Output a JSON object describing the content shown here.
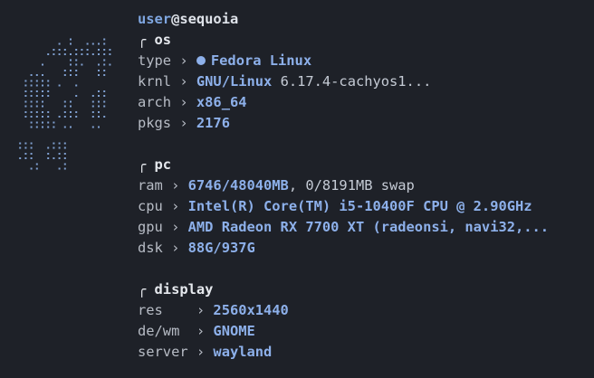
{
  "prompt": {
    "user": "user",
    "at": "@",
    "host": "sequoia"
  },
  "colors": {
    "background": "#1e2128",
    "accent": "#8db0ea",
    "text": "#c5cbd5"
  },
  "logo": {
    "icon": "fedora-ascii-dot-logo"
  },
  "sections": {
    "os": {
      "header": "╭ os",
      "type_key": "type ›",
      "type_val": "Fedora Linux",
      "type_icon": "fedora-icon",
      "krnl_key": "krnl ›",
      "krnl_val": "GNU/Linux",
      "krnl_extra": " 6.17.4-cachyos1...",
      "arch_key": "arch ›",
      "arch_val": "x86_64",
      "pkgs_key": "pkgs ›",
      "pkgs_val": "2176"
    },
    "pc": {
      "header": "╭ pc",
      "ram_key": "ram ›",
      "ram_val": "6746/48040MB",
      "ram_extra": ", 0/8191MB swap",
      "cpu_key": "cpu ›",
      "cpu_val": "Intel(R) Core(TM) i5-10400F CPU @ 2.90GHz",
      "gpu_key": "gpu ›",
      "gpu_val": "AMD Radeon RX 7700 XT (radeonsi, navi32,...",
      "dsk_key": "dsk ›",
      "dsk_val": "88G/937G"
    },
    "display": {
      "header": "╭ display",
      "res_key": "res    ›",
      "res_val": "2560x1440",
      "dewm_key": "de/wm  ›",
      "dewm_val": "GNOME",
      "server_key": "server ›",
      "server_val": "wayland"
    }
  }
}
